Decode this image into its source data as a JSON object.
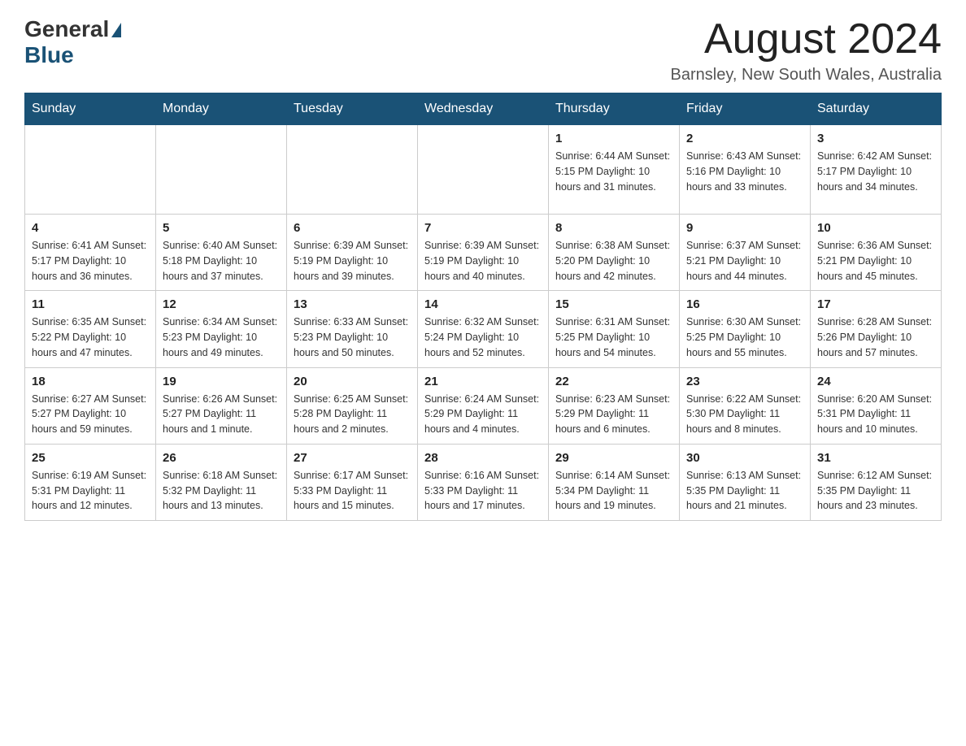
{
  "header": {
    "logo_general": "General",
    "logo_blue": "Blue",
    "title": "August 2024",
    "subtitle": "Barnsley, New South Wales, Australia"
  },
  "weekdays": [
    "Sunday",
    "Monday",
    "Tuesday",
    "Wednesday",
    "Thursday",
    "Friday",
    "Saturday"
  ],
  "weeks": [
    [
      {
        "day": "",
        "info": ""
      },
      {
        "day": "",
        "info": ""
      },
      {
        "day": "",
        "info": ""
      },
      {
        "day": "",
        "info": ""
      },
      {
        "day": "1",
        "info": "Sunrise: 6:44 AM\nSunset: 5:15 PM\nDaylight: 10 hours and 31 minutes."
      },
      {
        "day": "2",
        "info": "Sunrise: 6:43 AM\nSunset: 5:16 PM\nDaylight: 10 hours and 33 minutes."
      },
      {
        "day": "3",
        "info": "Sunrise: 6:42 AM\nSunset: 5:17 PM\nDaylight: 10 hours and 34 minutes."
      }
    ],
    [
      {
        "day": "4",
        "info": "Sunrise: 6:41 AM\nSunset: 5:17 PM\nDaylight: 10 hours and 36 minutes."
      },
      {
        "day": "5",
        "info": "Sunrise: 6:40 AM\nSunset: 5:18 PM\nDaylight: 10 hours and 37 minutes."
      },
      {
        "day": "6",
        "info": "Sunrise: 6:39 AM\nSunset: 5:19 PM\nDaylight: 10 hours and 39 minutes."
      },
      {
        "day": "7",
        "info": "Sunrise: 6:39 AM\nSunset: 5:19 PM\nDaylight: 10 hours and 40 minutes."
      },
      {
        "day": "8",
        "info": "Sunrise: 6:38 AM\nSunset: 5:20 PM\nDaylight: 10 hours and 42 minutes."
      },
      {
        "day": "9",
        "info": "Sunrise: 6:37 AM\nSunset: 5:21 PM\nDaylight: 10 hours and 44 minutes."
      },
      {
        "day": "10",
        "info": "Sunrise: 6:36 AM\nSunset: 5:21 PM\nDaylight: 10 hours and 45 minutes."
      }
    ],
    [
      {
        "day": "11",
        "info": "Sunrise: 6:35 AM\nSunset: 5:22 PM\nDaylight: 10 hours and 47 minutes."
      },
      {
        "day": "12",
        "info": "Sunrise: 6:34 AM\nSunset: 5:23 PM\nDaylight: 10 hours and 49 minutes."
      },
      {
        "day": "13",
        "info": "Sunrise: 6:33 AM\nSunset: 5:23 PM\nDaylight: 10 hours and 50 minutes."
      },
      {
        "day": "14",
        "info": "Sunrise: 6:32 AM\nSunset: 5:24 PM\nDaylight: 10 hours and 52 minutes."
      },
      {
        "day": "15",
        "info": "Sunrise: 6:31 AM\nSunset: 5:25 PM\nDaylight: 10 hours and 54 minutes."
      },
      {
        "day": "16",
        "info": "Sunrise: 6:30 AM\nSunset: 5:25 PM\nDaylight: 10 hours and 55 minutes."
      },
      {
        "day": "17",
        "info": "Sunrise: 6:28 AM\nSunset: 5:26 PM\nDaylight: 10 hours and 57 minutes."
      }
    ],
    [
      {
        "day": "18",
        "info": "Sunrise: 6:27 AM\nSunset: 5:27 PM\nDaylight: 10 hours and 59 minutes."
      },
      {
        "day": "19",
        "info": "Sunrise: 6:26 AM\nSunset: 5:27 PM\nDaylight: 11 hours and 1 minute."
      },
      {
        "day": "20",
        "info": "Sunrise: 6:25 AM\nSunset: 5:28 PM\nDaylight: 11 hours and 2 minutes."
      },
      {
        "day": "21",
        "info": "Sunrise: 6:24 AM\nSunset: 5:29 PM\nDaylight: 11 hours and 4 minutes."
      },
      {
        "day": "22",
        "info": "Sunrise: 6:23 AM\nSunset: 5:29 PM\nDaylight: 11 hours and 6 minutes."
      },
      {
        "day": "23",
        "info": "Sunrise: 6:22 AM\nSunset: 5:30 PM\nDaylight: 11 hours and 8 minutes."
      },
      {
        "day": "24",
        "info": "Sunrise: 6:20 AM\nSunset: 5:31 PM\nDaylight: 11 hours and 10 minutes."
      }
    ],
    [
      {
        "day": "25",
        "info": "Sunrise: 6:19 AM\nSunset: 5:31 PM\nDaylight: 11 hours and 12 minutes."
      },
      {
        "day": "26",
        "info": "Sunrise: 6:18 AM\nSunset: 5:32 PM\nDaylight: 11 hours and 13 minutes."
      },
      {
        "day": "27",
        "info": "Sunrise: 6:17 AM\nSunset: 5:33 PM\nDaylight: 11 hours and 15 minutes."
      },
      {
        "day": "28",
        "info": "Sunrise: 6:16 AM\nSunset: 5:33 PM\nDaylight: 11 hours and 17 minutes."
      },
      {
        "day": "29",
        "info": "Sunrise: 6:14 AM\nSunset: 5:34 PM\nDaylight: 11 hours and 19 minutes."
      },
      {
        "day": "30",
        "info": "Sunrise: 6:13 AM\nSunset: 5:35 PM\nDaylight: 11 hours and 21 minutes."
      },
      {
        "day": "31",
        "info": "Sunrise: 6:12 AM\nSunset: 5:35 PM\nDaylight: 11 hours and 23 minutes."
      }
    ]
  ]
}
